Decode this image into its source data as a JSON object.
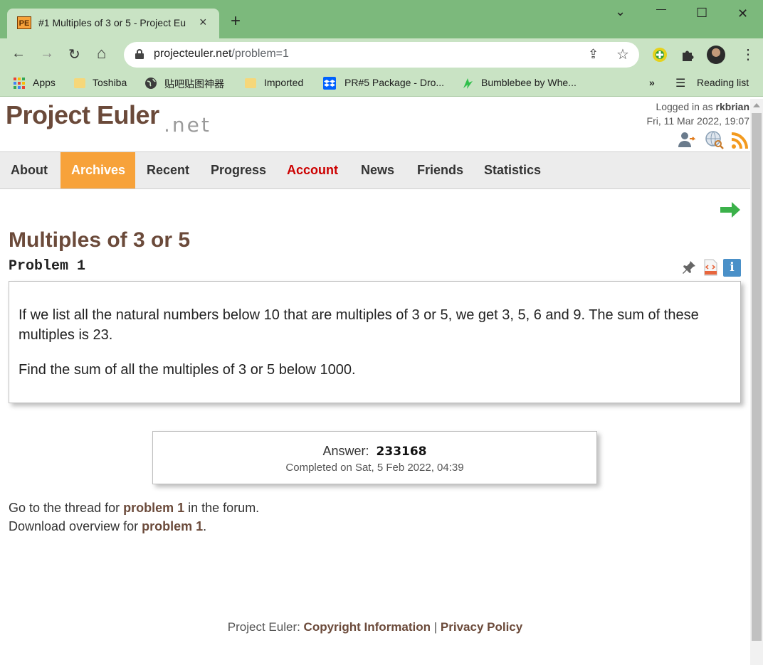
{
  "browser": {
    "tab_title": "#1 Multiples of 3 or 5 - Project Eu",
    "tab_favicon_text": "PE",
    "url_host": "projecteuler.net",
    "url_path": "/problem=1",
    "bookmarks": [
      "Apps",
      "Toshiba",
      "贴吧贴图神器",
      "Imported",
      "PR#5 Package - Dro...",
      "Bumblebee by Whe..."
    ],
    "overflow": "»",
    "reading_list": "Reading list"
  },
  "header": {
    "logo": "Project Euler",
    "logo_suffix": ".net",
    "logged_in_prefix": "Logged in as ",
    "username": "rkbrian",
    "datetime": "Fri, 11 Mar 2022, 19:07"
  },
  "nav": [
    "About",
    "Archives",
    "Recent",
    "Progress",
    "Account",
    "News",
    "Friends",
    "Statistics"
  ],
  "problem": {
    "title": "Multiples of 3 or 5",
    "number_label": "Problem 1",
    "paragraph1": "If we list all the natural numbers below 10 that are multiples of 3 or 5, we get 3, 5, 6 and 9. The sum of these multiples is 23.",
    "paragraph2": "Find the sum of all the multiples of 3 or 5 below 1000."
  },
  "answer": {
    "label": "Answer:",
    "value": "233168",
    "completed": "Completed on Sat, 5 Feb 2022, 04:39"
  },
  "links": {
    "thread_prefix": "Go to the thread for ",
    "thread_link": "problem 1",
    "thread_suffix": " in the forum.",
    "download_prefix": "Download overview for ",
    "download_link": "problem 1",
    "download_suffix": "."
  },
  "footer": {
    "prefix": "Project Euler: ",
    "copyright": "Copyright Information",
    "sep": " | ",
    "privacy": "Privacy Policy"
  },
  "colors": {
    "brand_brown": "#6b4a3a",
    "nav_active": "#f7a23a",
    "account_red": "#cc0000",
    "chrome_green": "#7cb97c",
    "chrome_toolbar": "#c9e3c4"
  },
  "icons": {
    "tab_close": "×",
    "new_tab": "+",
    "minimize": "—",
    "maximize": "☐",
    "close": "✕",
    "chevron": "⌄",
    "back": "←",
    "forward": "→",
    "reload": "↻",
    "home": "⌂",
    "share": "⇪",
    "star": "☆",
    "extensions": "✚",
    "menu": "⋮",
    "reading": "☰",
    "info": "i"
  }
}
